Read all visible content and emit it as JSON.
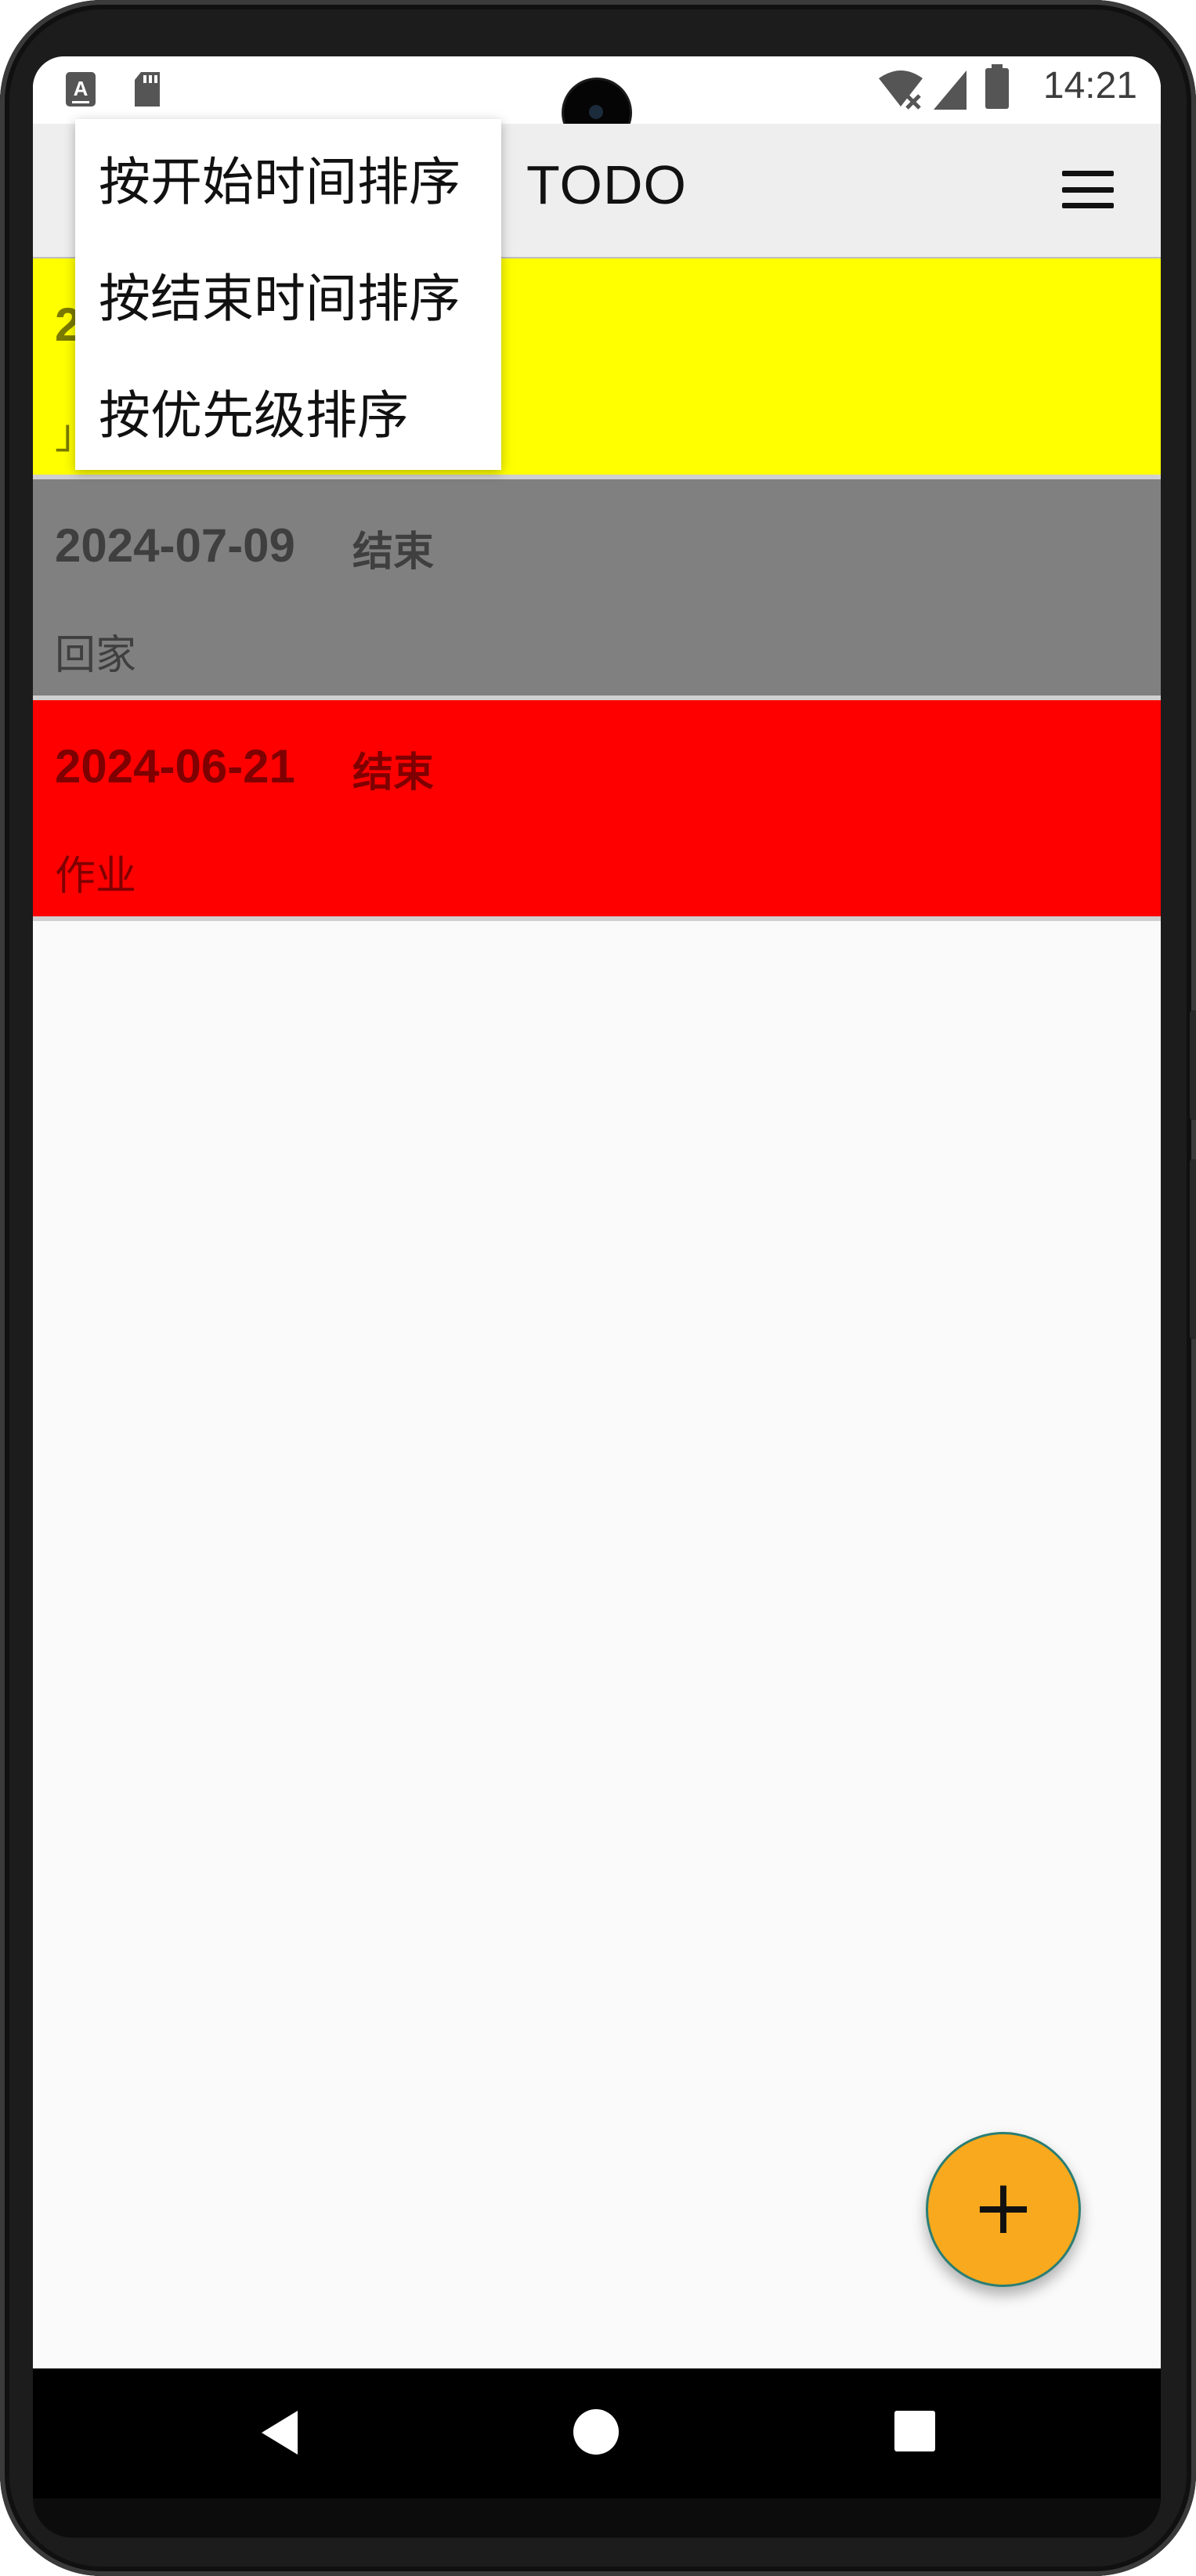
{
  "status_bar": {
    "time": "14:21",
    "left_icons": [
      "keyboard-a-icon",
      "sd-card-icon"
    ],
    "right_icons": [
      "wifi-off-icon",
      "signal-icon",
      "battery-icon"
    ]
  },
  "app_bar": {
    "title": "TODO",
    "menu_icon": "hamburger-menu-icon"
  },
  "sort_menu": {
    "items": [
      {
        "label": "按开始时间排序"
      },
      {
        "label": "按结束时间排序"
      },
      {
        "label": "按优先级排序"
      }
    ]
  },
  "todos": [
    {
      "date": "2",
      "status": "",
      "name": "」",
      "color": "#ffff00",
      "text_color": "#7a7a00"
    },
    {
      "date": "2024-07-09",
      "status": "结束",
      "name": "回家",
      "color": "#808080",
      "text_color": "#3f3f3f"
    },
    {
      "date": "2024-06-21",
      "status": "结束",
      "name": "作业",
      "color": "#ff0000",
      "text_color": "#7f0000"
    }
  ],
  "fab": {
    "icon": "plus-icon",
    "symbol": "+",
    "color": "#f9a91d"
  },
  "nav_bar": {
    "icons": [
      "back-icon",
      "home-icon",
      "recents-icon"
    ]
  }
}
